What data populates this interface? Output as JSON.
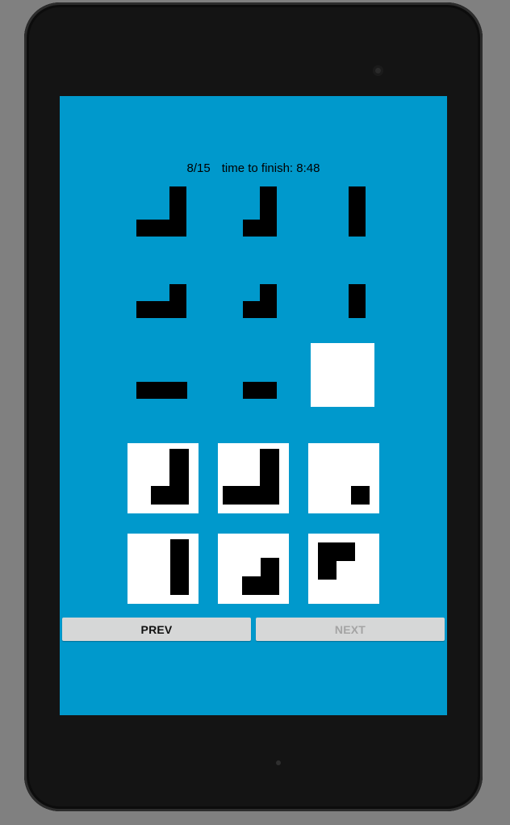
{
  "header": {
    "progress": "8/15",
    "timer_label": "time to finish:",
    "timer_value": "8:48"
  },
  "puzzle": {
    "grid_rows": 3,
    "grid_cols": 3,
    "missing_cell": "row 3, column 3",
    "answer_options_count": 6
  },
  "colors": {
    "screen_background": "#0099cc",
    "shape": "#000000",
    "answer_tile": "#ffffff",
    "button_background": "#d6d7d7",
    "button_enabled_text": "#111111",
    "button_disabled_text": "#a4a4a4"
  },
  "navigation": {
    "prev_label": "PREV",
    "next_label": "NEXT"
  }
}
